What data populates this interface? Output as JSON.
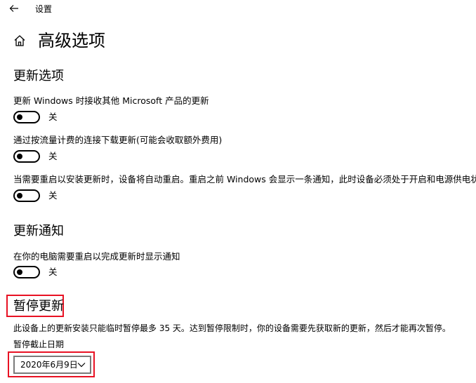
{
  "window": {
    "back_icon": "arrow-left-icon",
    "title": "设置"
  },
  "page": {
    "home_icon": "home-icon",
    "title": "高级选项"
  },
  "update_options": {
    "heading": "更新选项",
    "items": [
      {
        "label": "更新 Windows 时接收其他 Microsoft 产品的更新",
        "state": "关",
        "on": false
      },
      {
        "label": "通过按流量计费的连接下载更新(可能会收取额外费用)",
        "state": "关",
        "on": false
      },
      {
        "label": "当需要重启以安装更新时，设备将自动重启。重启之前 Windows 会显示一条通知，此时设备必须处于开启和电源供电状态。",
        "state": "关",
        "on": false
      }
    ]
  },
  "update_notifications": {
    "heading": "更新通知",
    "items": [
      {
        "label": "在你的电脑需要重启以完成更新时显示通知",
        "state": "关",
        "on": false
      }
    ]
  },
  "pause_updates": {
    "heading": "暂停更新",
    "description": "此设备上的更新安装只能临时暂停最多 35 天。达到暂停限制时，你的设备需要先获取新的更新，然后才能再次暂停。",
    "date_label": "暂停截止日期",
    "date_value": "2020年6月9日",
    "dropdown_icon": "chevron-down-icon",
    "highlight_color": "#e81123"
  }
}
